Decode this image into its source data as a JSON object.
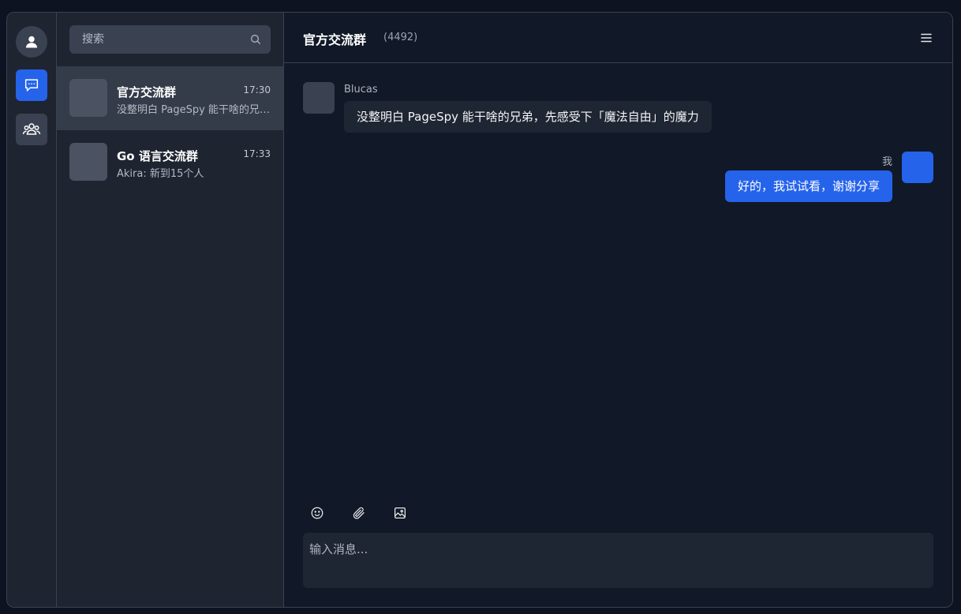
{
  "rail": {
    "items": [
      {
        "icon": "user-icon"
      },
      {
        "icon": "chat-icon",
        "active": true
      },
      {
        "icon": "group-icon"
      }
    ]
  },
  "search": {
    "placeholder": "搜索"
  },
  "conversations": [
    {
      "name": "官方交流群",
      "time": "17:30",
      "preview": "没整明白 PageSpy 能干啥的兄弟，先感受下「魔法自由」的魔力",
      "active": true
    },
    {
      "name": "Go 语言交流群",
      "time": "17:33",
      "preview": "Akira: 新到15个人",
      "active": false
    }
  ],
  "chat": {
    "title": "官方交流群",
    "member_count": "(4492)",
    "messages": [
      {
        "sender": "Blucas",
        "text": "没整明白 PageSpy 能干啥的兄弟，先感受下「魔法自由」的魔力",
        "direction": "incoming"
      },
      {
        "sender": "我",
        "text": "好的，我试试看，谢谢分享",
        "direction": "outgoing"
      }
    ]
  },
  "composer": {
    "placeholder": "输入消息..."
  },
  "colors": {
    "accent": "#2563eb",
    "background": "#111827",
    "sidebar": "#1e2430",
    "bubble_incoming": "#1f2633",
    "avatar_placeholder": "#4b5261"
  }
}
